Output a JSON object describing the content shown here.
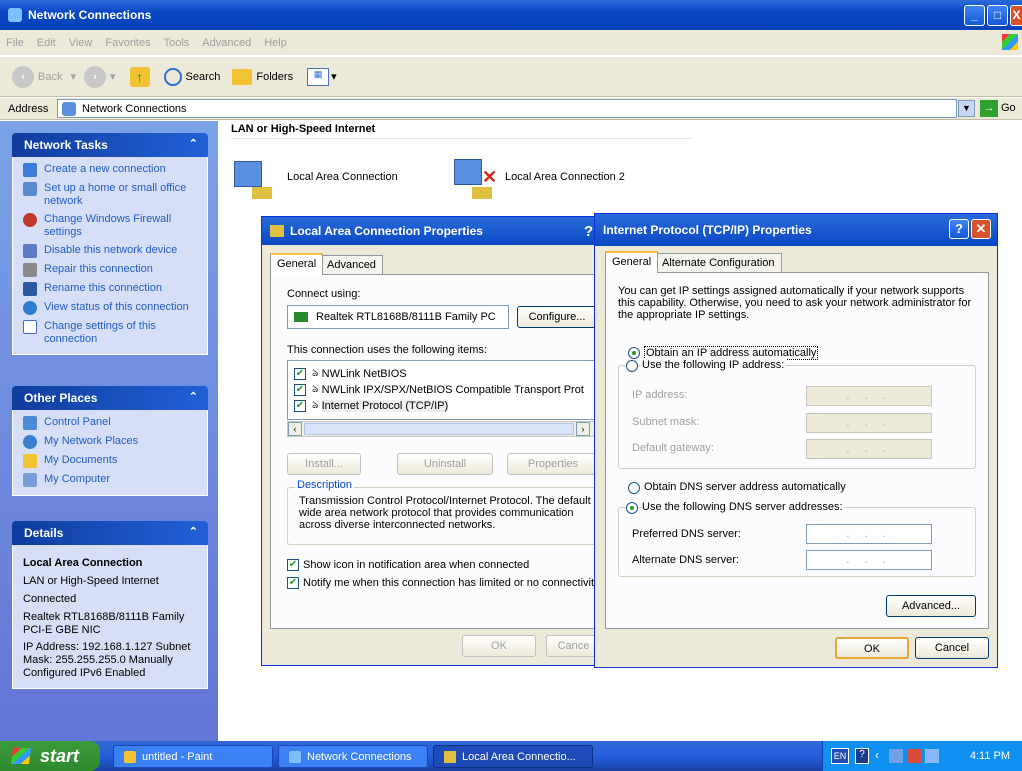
{
  "window": {
    "title": "Network Connections"
  },
  "menu": [
    "File",
    "Edit",
    "View",
    "Favorites",
    "Tools",
    "Advanced",
    "Help"
  ],
  "toolbar": {
    "back": "Back",
    "search": "Search",
    "folders": "Folders"
  },
  "address": {
    "label": "Address",
    "value": "Network Connections",
    "go": "Go"
  },
  "network_tasks": {
    "title": "Network Tasks",
    "items": [
      "Create a new connection",
      "Set up a home or small office network",
      "Change Windows Firewall settings",
      "Disable this network device",
      "Repair this connection",
      "Rename this connection",
      "View status of this connection",
      "Change settings of this connection"
    ]
  },
  "other_places": {
    "title": "Other Places",
    "items": [
      "Control Panel",
      "My Network Places",
      "My Documents",
      "My Computer"
    ]
  },
  "details": {
    "title": "Details",
    "name": "Local Area Connection",
    "lines": [
      "LAN or High-Speed Internet",
      "Connected",
      "Realtek RTL8168B/8111B Family PCI-E GBE NIC",
      "IP Address: 192.168.1.127 Subnet Mask: 255.255.255.0 Manually Configured IPv6 Enabled"
    ]
  },
  "content": {
    "group_header": "LAN or High-Speed Internet",
    "conn1": "Local Area Connection",
    "conn2": "Local Area Connection 2"
  },
  "lac_props": {
    "title": "Local Area Connection Properties",
    "tab_general": "General",
    "tab_advanced": "Advanced",
    "connect_using": "Connect using:",
    "adapter": "Realtek RTL8168B/8111B Family PC",
    "configure": "Configure...",
    "items_label": "This connection uses the following items:",
    "items": [
      "NWLink NetBIOS",
      "NWLink IPX/SPX/NetBIOS Compatible Transport Prot",
      "Internet Protocol (TCP/IP)"
    ],
    "install": "Install...",
    "uninstall": "Uninstall",
    "properties": "Properties",
    "desc_title": "Description",
    "desc": "Transmission Control Protocol/Internet Protocol. The default wide area network protocol that provides communication across diverse interconnected networks.",
    "chk1": "Show icon in notification area when connected",
    "chk2": "Notify me when this connection has limited or no connectivity",
    "ok": "OK",
    "cancel": "Cance"
  },
  "tcpip": {
    "title": "Internet Protocol (TCP/IP) Properties",
    "tab_general": "General",
    "tab_alt": "Alternate Configuration",
    "intro": "You can get IP settings assigned automatically if your network supports this capability. Otherwise, you need to ask your network administrator for the appropriate IP settings.",
    "obtain_ip": "Obtain an IP address automatically",
    "use_ip": "Use the following IP address:",
    "ip_label": "IP address:",
    "subnet_label": "Subnet mask:",
    "gateway_label": "Default gateway:",
    "obtain_dns": "Obtain DNS server address automatically",
    "use_dns": "Use the following DNS server addresses:",
    "pref_dns": "Preferred DNS server:",
    "alt_dns": "Alternate DNS server:",
    "dots": ". . .",
    "advanced": "Advanced...",
    "ok": "OK",
    "cancel": "Cancel"
  },
  "taskbar": {
    "start": "start",
    "tasks": [
      "untitled - Paint",
      "Network Connections",
      "Local Area Connectio..."
    ],
    "lang": "EN",
    "time": "4:11 PM"
  }
}
